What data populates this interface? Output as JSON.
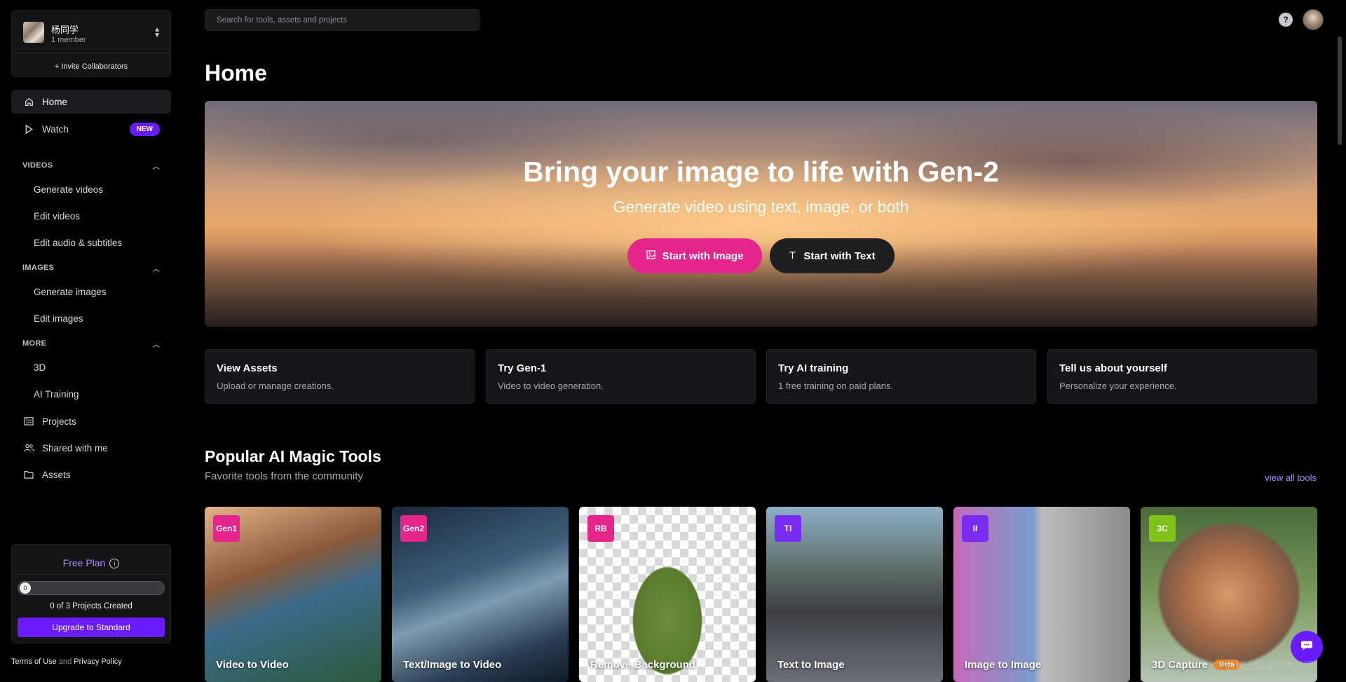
{
  "team": {
    "name": "杨同学",
    "members": "1 member",
    "invite": "+ Invite Collaborators"
  },
  "nav": {
    "home": "Home",
    "watch": "Watch",
    "watch_badge": "NEW",
    "videos_header": "VIDEOS",
    "videos_items": [
      "Generate videos",
      "Edit videos",
      "Edit audio & subtitles"
    ],
    "images_header": "IMAGES",
    "images_items": [
      "Generate images",
      "Edit images"
    ],
    "more_header": "MORE",
    "more_items": [
      "3D",
      "AI Training"
    ],
    "projects": "Projects",
    "shared": "Shared with me",
    "assets": "Assets"
  },
  "plan": {
    "title": "Free Plan",
    "progress_label": "0",
    "projects_used": 0,
    "projects_limit": 3,
    "count_text": "0 of 3 Projects Created",
    "upgrade": "Upgrade to Standard"
  },
  "footer": {
    "terms": "Terms of Use",
    "and": "and",
    "privacy": "Privacy Policy"
  },
  "search": {
    "placeholder": "Search for tools, assets and projects"
  },
  "page": {
    "title": "Home"
  },
  "hero": {
    "title": "Bring your image to life with Gen-2",
    "subtitle": "Generate video using text, image, or both",
    "btn_image": "Start with Image",
    "btn_text": "Start with Text"
  },
  "quick_cards": [
    {
      "title": "View Assets",
      "desc": "Upload or manage creations."
    },
    {
      "title": "Try Gen-1",
      "desc": "Video to video generation."
    },
    {
      "title": "Try AI training",
      "desc": "1 free training on paid plans."
    },
    {
      "title": "Tell us about yourself",
      "desc": "Personalize your experience."
    }
  ],
  "tools_section": {
    "title": "Popular AI Magic Tools",
    "subtitle": "Favorite tools from the community",
    "view_all": "view all tools"
  },
  "tools": [
    {
      "tag": "Gen1",
      "name": "Video to Video",
      "color": "#e5258c"
    },
    {
      "tag": "Gen2",
      "name": "Text/Image to Video",
      "color": "#e5258c"
    },
    {
      "tag": "RB",
      "name": "Remove Background",
      "color": "#e5258c"
    },
    {
      "tag": "TI",
      "name": "Text to Image",
      "color": "#7a2cf0"
    },
    {
      "tag": "II",
      "name": "Image to Image",
      "color": "#7a2cf0"
    },
    {
      "tag": "3C",
      "name": "3D Capture",
      "color": "#7fc21a",
      "badge": "Beta"
    }
  ],
  "watermark": "@稀土掘金技术社区",
  "colors": {
    "accent_purple": "#6b1cff",
    "accent_pink": "#e5258c",
    "background": "#000000"
  }
}
